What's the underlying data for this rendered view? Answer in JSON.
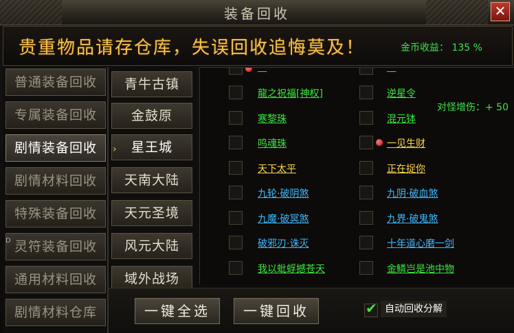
{
  "window": {
    "title": "装备回收",
    "close_label": "✕"
  },
  "banner": {
    "warning": "贵重物品请存仓库，失误回收追悔莫及！",
    "income_label": "金币收益：",
    "income_value": "135 %"
  },
  "side_bonus": "对怪增伤：+ 50",
  "categories": [
    {
      "label": "普通装备回收",
      "active": false
    },
    {
      "label": "专属装备回收",
      "active": false
    },
    {
      "label": "剧情装备回收",
      "active": true
    },
    {
      "label": "剧情材料回收",
      "active": false
    },
    {
      "label": "特殊装备回收",
      "active": false
    },
    {
      "label": "灵符装备回收",
      "active": false
    },
    {
      "label": "通用材料回收",
      "active": false
    },
    {
      "label": "剧情材料仓库",
      "active": false
    }
  ],
  "locations": [
    {
      "label": "青牛古镇",
      "active": false
    },
    {
      "label": "金鼓原",
      "active": false
    },
    {
      "label": "星王城",
      "active": true
    },
    {
      "label": "天南大陆",
      "active": false
    },
    {
      "label": "天元圣境",
      "active": false
    },
    {
      "label": "风元大陆",
      "active": false
    },
    {
      "label": "域外战场",
      "active": false
    }
  ],
  "items": [
    {
      "left": "龍之祝福[神权]",
      "left_color": "green",
      "right": "逆星令",
      "right_color": "green"
    },
    {
      "left": "寒黎珠",
      "left_color": "green",
      "right": "混元钵",
      "right_color": "green"
    },
    {
      "left": "鸣魂珠",
      "left_color": "green",
      "right": "一见生财",
      "right_color": "yellow"
    },
    {
      "left": "天下太平",
      "left_color": "yellow",
      "right": "正在捉你",
      "right_color": "yellow"
    },
    {
      "left": "九轮·破阴煞",
      "left_color": "blue",
      "right": "九阴·破血煞",
      "right_color": "blue"
    },
    {
      "left": "九魔·破冥煞",
      "left_color": "blue",
      "right": "九界·破鬼煞",
      "right_color": "blue"
    },
    {
      "left": "破邪刃·诛灭",
      "left_color": "blue",
      "right": "十年道心磨一剑",
      "right_color": "blue"
    },
    {
      "left": "我以蚍蜉撼苍天",
      "left_color": "green",
      "right": "金鳞岂是池中物",
      "right_color": "green"
    }
  ],
  "buttons": {
    "select_all": "一键全选",
    "recycle": "一键回收"
  },
  "auto_decompose": {
    "label": "自动回收分解",
    "checked": true,
    "check_glyph": "✔"
  },
  "colors": {
    "accent_gold": "#f6c14a",
    "text_green": "#39e83c",
    "text_blue": "#3fb8ff",
    "text_yellow": "#ffd84a"
  }
}
